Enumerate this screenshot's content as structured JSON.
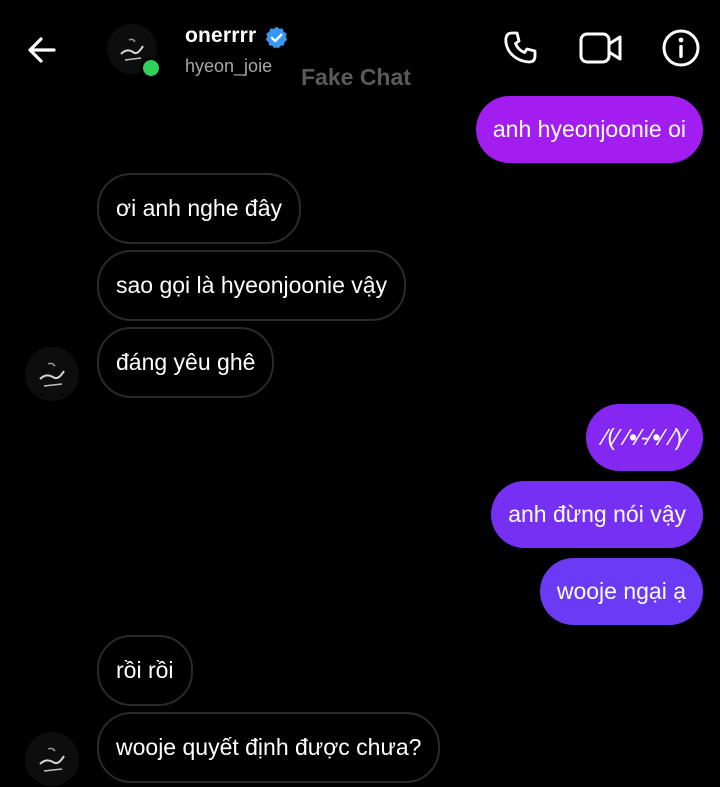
{
  "header": {
    "username": "onerrrr",
    "handle": "hyeon_joie",
    "watermark": "Fake Chat",
    "icons": [
      "back-arrow-icon",
      "verified-badge-icon",
      "phone-icon",
      "video-camera-icon",
      "info-icon"
    ],
    "online_color": "#2fd15a",
    "verified_color": "#3897f0"
  },
  "colors": {
    "sent_top": "#a21df0",
    "sent_bottom": "#6a3af4",
    "received_border": "#2a2a2a",
    "background": "#000000"
  },
  "messages": [
    {
      "side": "sent",
      "text": "anh hyeonjoonie oi"
    },
    {
      "side": "received",
      "text": "ơi anh nghe đây"
    },
    {
      "side": "received",
      "text": "sao gọi là hyeonjoonie vậy"
    },
    {
      "side": "received",
      "text": "đáng yêu ghê"
    },
    {
      "side": "sent",
      "text": "⁄(⁄ ⁄•⁄-⁄•⁄ ⁄)⁄"
    },
    {
      "side": "sent",
      "text": "anh đừng nói vậy"
    },
    {
      "side": "sent",
      "text": "wooje ngại ạ"
    },
    {
      "side": "received",
      "text": "rồi rồi"
    },
    {
      "side": "received",
      "text": "wooje quyết định được chưa?"
    }
  ]
}
